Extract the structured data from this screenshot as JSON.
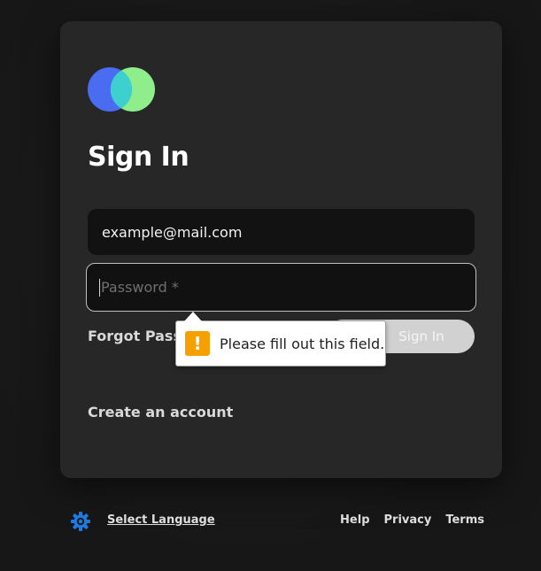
{
  "brand": {
    "logo_colors": [
      "#4a6cf0",
      "#8fed8c",
      "#3ecfcf"
    ]
  },
  "signin": {
    "title": "Sign In",
    "email_value": "example@mail.com",
    "password_placeholder": "Password *",
    "forgot_label": "Forgot Passw",
    "submit_label": "Sign In",
    "create_account_label": "Create an account"
  },
  "validation": {
    "message": "Please fill out this field.",
    "icon": "warning-icon",
    "icon_color": "#f59f00"
  },
  "footer": {
    "language_icon": "settings-gear-icon",
    "language_label": "Select Language",
    "links": [
      "Help",
      "Privacy",
      "Terms"
    ]
  }
}
